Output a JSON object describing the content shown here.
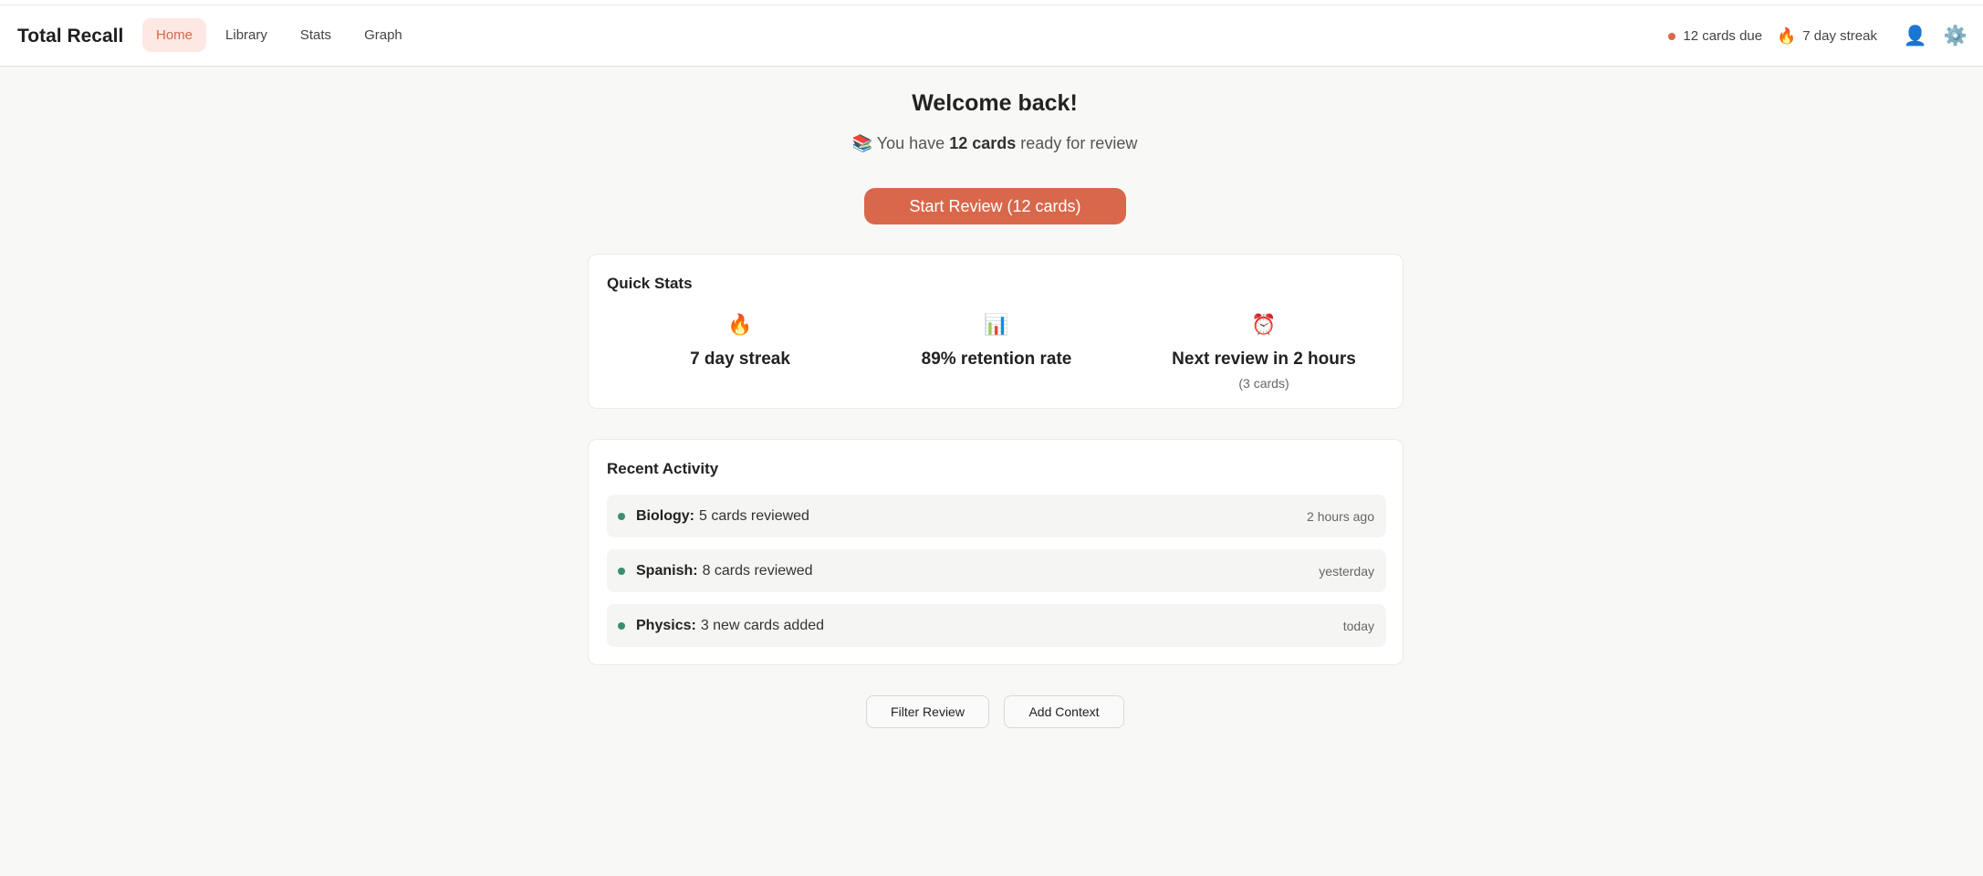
{
  "app": {
    "title": "Total Recall"
  },
  "nav": {
    "items": [
      {
        "label": "Home",
        "active": true
      },
      {
        "label": "Library",
        "active": false
      },
      {
        "label": "Stats",
        "active": false
      },
      {
        "label": "Graph",
        "active": false
      }
    ]
  },
  "header": {
    "due_text": "12 cards due",
    "streak_icon": "🔥",
    "streak_text": "7 day streak",
    "user_icon": "👤",
    "settings_icon": "⚙️"
  },
  "colors": {
    "accent": "#d9674b",
    "accent_soft": "#fde8e3",
    "activity_dot": "#3a8f6e"
  },
  "welcome": {
    "title": "Welcome back!",
    "icon": "📚",
    "prefix": "You have",
    "count_text": "12 cards",
    "suffix": "ready for review"
  },
  "start_button": {
    "label": "Start Review (12 cards)"
  },
  "quick_stats": {
    "title": "Quick Stats",
    "items": [
      {
        "icon": "🔥",
        "value": "7 day streak",
        "note": ""
      },
      {
        "icon": "📊",
        "value": "89% retention rate",
        "note": ""
      },
      {
        "icon": "⏰",
        "value": "Next review in 2 hours",
        "note": "(3 cards)"
      }
    ]
  },
  "recent_activity": {
    "title": "Recent Activity",
    "items": [
      {
        "subject": "Biology:",
        "text": "5 cards reviewed",
        "time": "2 hours ago"
      },
      {
        "subject": "Spanish:",
        "text": "8 cards reviewed",
        "time": "yesterday"
      },
      {
        "subject": "Physics:",
        "text": "3 new cards added",
        "time": "today"
      }
    ]
  },
  "actions": {
    "filter_label": "Filter Review",
    "context_label": "Add Context"
  }
}
